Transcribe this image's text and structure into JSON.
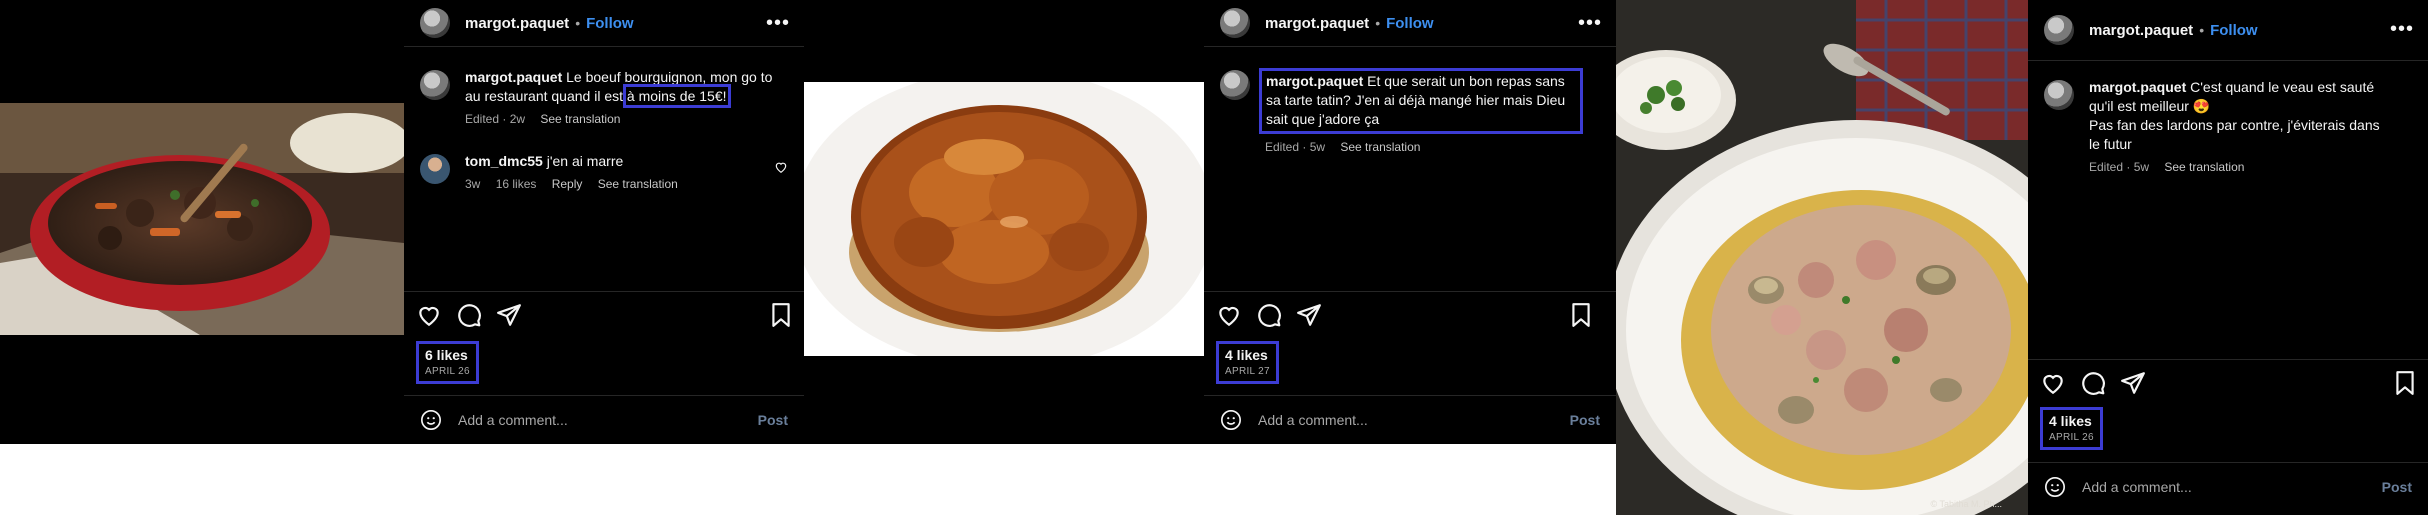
{
  "posts": [
    {
      "username": "margot.paquet",
      "separator": "•",
      "follow_label": "Follow",
      "more_label": "•••",
      "caption_user": "margot.paquet",
      "caption_pre": "Le boeuf bourguignon, mon go to au restaurant quand il est ",
      "caption_hl": "à moins de 15€!",
      "caption_meta": {
        "edited": "Edited · 2w",
        "translate": "See translation"
      },
      "reply": {
        "user": "tom_dmc55",
        "text": "j'en ai marre",
        "age": "3w",
        "likes": "16 likes",
        "reply_label": "Reply",
        "translate": "See translation"
      },
      "likes": "6 likes",
      "date": "APRIL 26",
      "add_comment_placeholder": "Add a comment...",
      "post_label": "Post",
      "image": "beef-bourguignon-photo"
    },
    {
      "username": "margot.paquet",
      "separator": "•",
      "follow_label": "Follow",
      "more_label": "•••",
      "caption_user": "margot.paquet",
      "caption_text": "Et que serait un bon repas sans sa tarte tatin? J'en ai déjà mangé hier mais Dieu sait que j'adore ça",
      "caption_meta": {
        "edited": "Edited · 5w",
        "translate": "See translation"
      },
      "likes": "4 likes",
      "date": "APRIL 27",
      "add_comment_placeholder": "Add a comment...",
      "post_label": "Post",
      "image": "tarte-tatin-photo"
    },
    {
      "username": "margot.paquet",
      "separator": "•",
      "follow_label": "Follow",
      "more_label": "•••",
      "caption_user": "margot.paquet",
      "caption_line1": "C'est quand le veau est sauté qu'il est meilleur 😍",
      "caption_line2": "Pas fan des lardons par contre, j'éviterais dans le futur",
      "caption_meta": {
        "edited": "Edited · 5w",
        "translate": "See translation"
      },
      "likes": "4 likes",
      "date": "APRIL 26",
      "add_comment_placeholder": "Add a comment...",
      "post_label": "Post",
      "image": "sauteed-veal-photo",
      "image_credit": "© Tabitha M. Ph..."
    }
  ],
  "colors": {
    "accent_follow": "#3d8ff0",
    "highlight": "#3c3cd4",
    "background": "#000000"
  }
}
